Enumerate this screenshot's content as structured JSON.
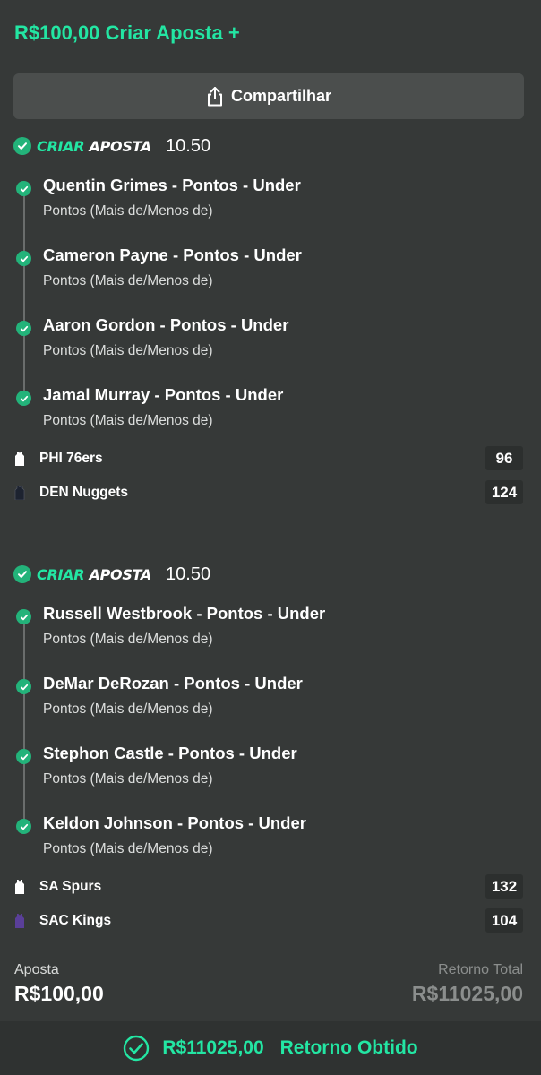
{
  "header": {
    "title": "R$100,00 Criar Aposta +"
  },
  "share": {
    "label": "Compartilhar"
  },
  "bets": [
    {
      "brand_part1": "CRIAR",
      "brand_part2": "APOSTA",
      "odds": "10.50",
      "selections": [
        {
          "title": "Quentin Grimes - Pontos - Under",
          "market": "Pontos (Mais de/Menos de)"
        },
        {
          "title": "Cameron Payne - Pontos - Under",
          "market": "Pontos (Mais de/Menos de)"
        },
        {
          "title": "Aaron Gordon - Pontos - Under",
          "market": "Pontos (Mais de/Menos de)"
        },
        {
          "title": "Jamal Murray - Pontos - Under",
          "market": "Pontos (Mais de/Menos de)"
        }
      ],
      "teams": [
        {
          "name": "PHI 76ers",
          "score": "96",
          "jersey_color": "#ffffff"
        },
        {
          "name": "DEN Nuggets",
          "score": "124",
          "jersey_color": "#1d2330"
        }
      ]
    },
    {
      "brand_part1": "CRIAR",
      "brand_part2": "APOSTA",
      "odds": "10.50",
      "selections": [
        {
          "title": "Russell Westbrook - Pontos - Under",
          "market": "Pontos (Mais de/Menos de)"
        },
        {
          "title": "DeMar DeRozan - Pontos - Under",
          "market": "Pontos (Mais de/Menos de)"
        },
        {
          "title": "Stephon Castle - Pontos - Under",
          "market": "Pontos (Mais de/Menos de)"
        },
        {
          "title": "Keldon Johnson - Pontos - Under",
          "market": "Pontos (Mais de/Menos de)"
        }
      ],
      "teams": [
        {
          "name": "SA Spurs",
          "score": "132",
          "jersey_color": "#ffffff"
        },
        {
          "name": "SAC Kings",
          "score": "104",
          "jersey_color": "#5a3f99"
        }
      ]
    }
  ],
  "summary": {
    "stake_label": "Aposta",
    "stake_value": "R$100,00",
    "return_label": "Retorno Total",
    "return_value": "R$11025,00"
  },
  "footer": {
    "amount": "R$11025,00",
    "label": "Retorno Obtido"
  },
  "colors": {
    "accent": "#23e6a3",
    "check": "#23b37a",
    "background": "#363938"
  },
  "icons": {
    "share": "share-icon",
    "check": "check-circle-icon",
    "jersey": "jersey-icon"
  }
}
